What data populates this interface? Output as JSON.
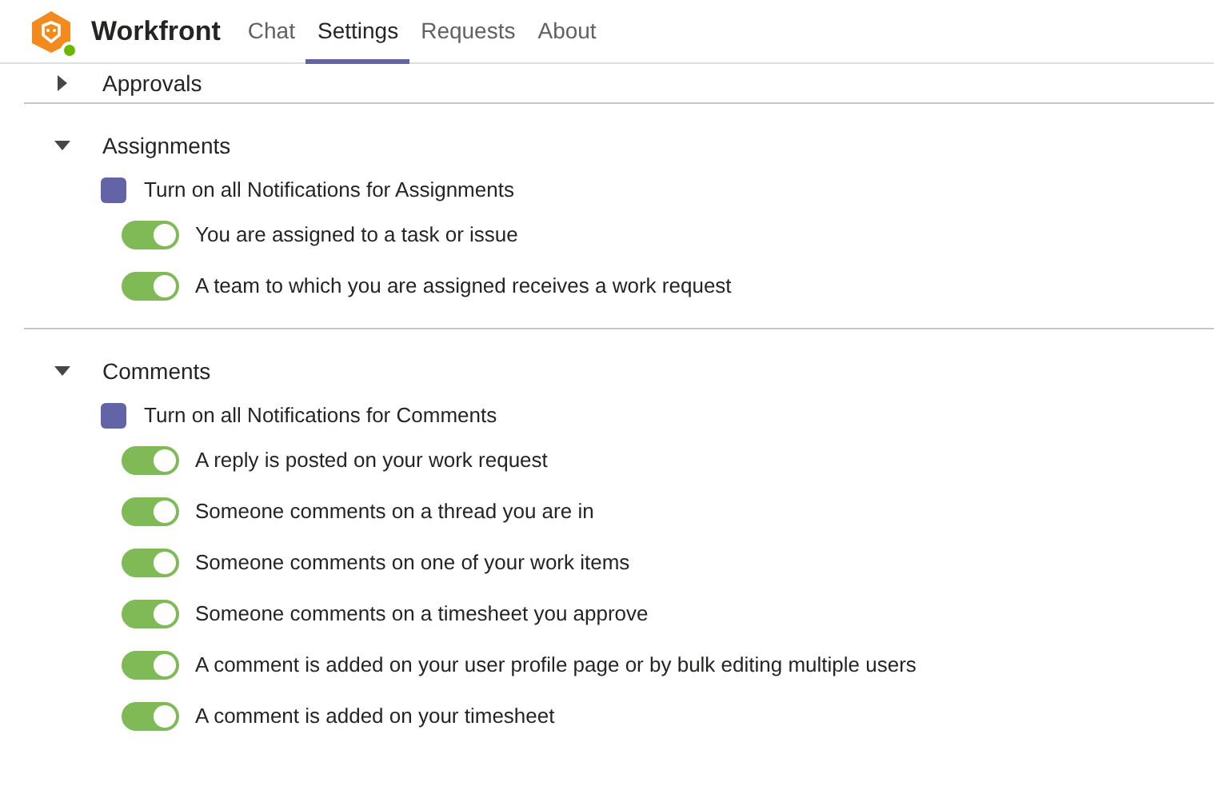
{
  "app": {
    "title": "Workfront",
    "online": true
  },
  "tabs": [
    {
      "label": "Chat",
      "selected": false
    },
    {
      "label": "Settings",
      "selected": true
    },
    {
      "label": "Requests",
      "selected": false
    },
    {
      "label": "About",
      "selected": false
    }
  ],
  "sections": [
    {
      "title": "Approvals",
      "expanded": false
    },
    {
      "title": "Assignments",
      "expanded": true,
      "master": {
        "label": "Turn on all Notifications for Assignments",
        "checked": true
      },
      "toggles": [
        {
          "label": "You are assigned to a task or issue",
          "on": true
        },
        {
          "label": "A team to which you are assigned receives a work request",
          "on": true
        }
      ]
    },
    {
      "title": "Comments",
      "expanded": true,
      "master": {
        "label": "Turn on all Notifications for Comments",
        "checked": true
      },
      "toggles": [
        {
          "label": "A reply is posted on your work request",
          "on": true
        },
        {
          "label": "Someone comments on a thread you are in",
          "on": true
        },
        {
          "label": "Someone comments on one of your work items",
          "on": true
        },
        {
          "label": "Someone comments on a timesheet you approve",
          "on": true
        },
        {
          "label": "A comment is added on your user profile page or by bulk editing multiple users",
          "on": true
        },
        {
          "label": "A comment is added on your timesheet",
          "on": true
        }
      ]
    }
  ]
}
